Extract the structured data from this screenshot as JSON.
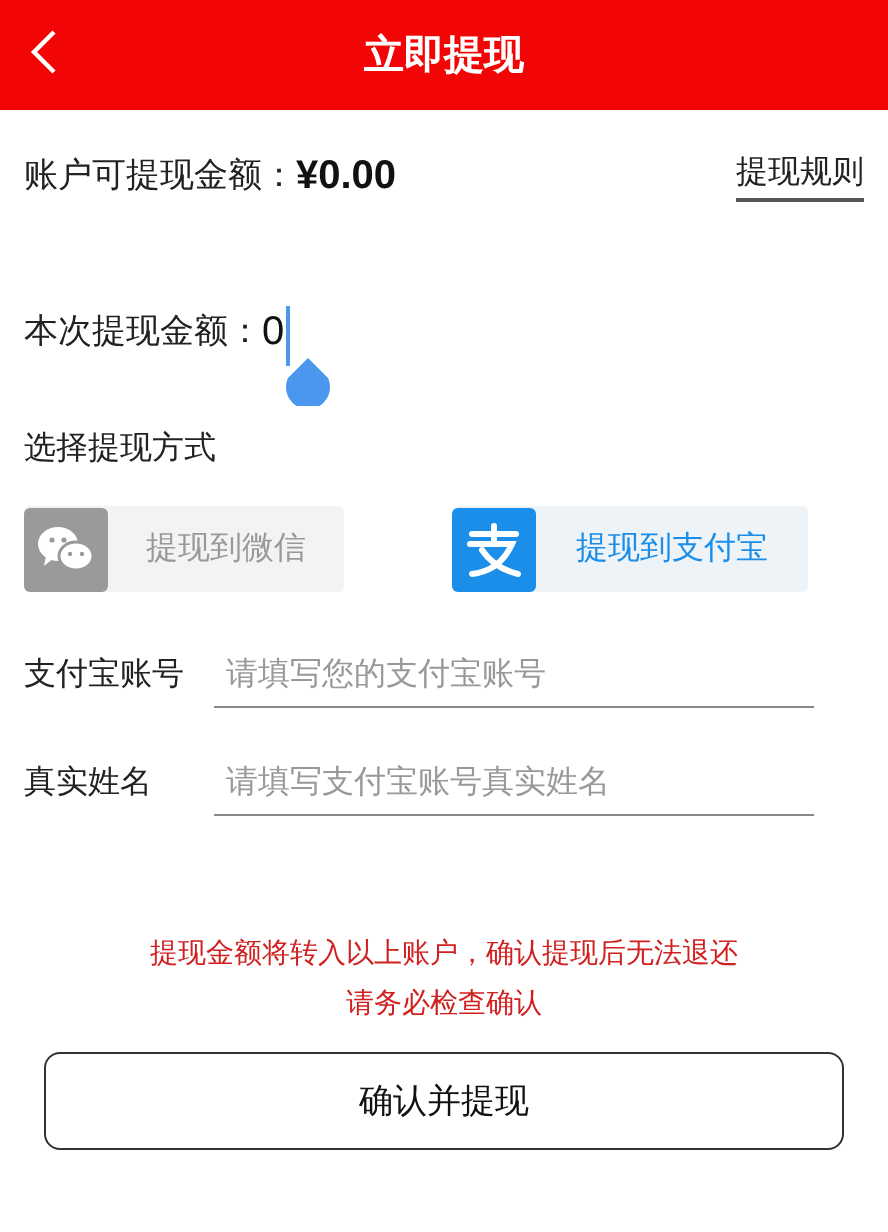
{
  "header": {
    "title": "立即提现"
  },
  "balance": {
    "label": "账户可提现金额：",
    "value": "¥0.00",
    "rules_link": "提现规则"
  },
  "amount": {
    "label": "本次提现金额：",
    "value": "0"
  },
  "method_heading": "选择提现方式",
  "methods": [
    {
      "kind": "wechat",
      "label": "提现到微信",
      "selected": false
    },
    {
      "kind": "alipay",
      "label": "提现到支付宝",
      "selected": true
    }
  ],
  "fields": [
    {
      "label": "支付宝账号",
      "placeholder": "请填写您的支付宝账号"
    },
    {
      "label": "真实姓名",
      "placeholder": "请填写支付宝账号真实姓名"
    }
  ],
  "notice": [
    "提现金额将转入以上账户，确认提现后无法退还",
    "请务必检查确认"
  ],
  "confirm_button": "确认并提现"
}
